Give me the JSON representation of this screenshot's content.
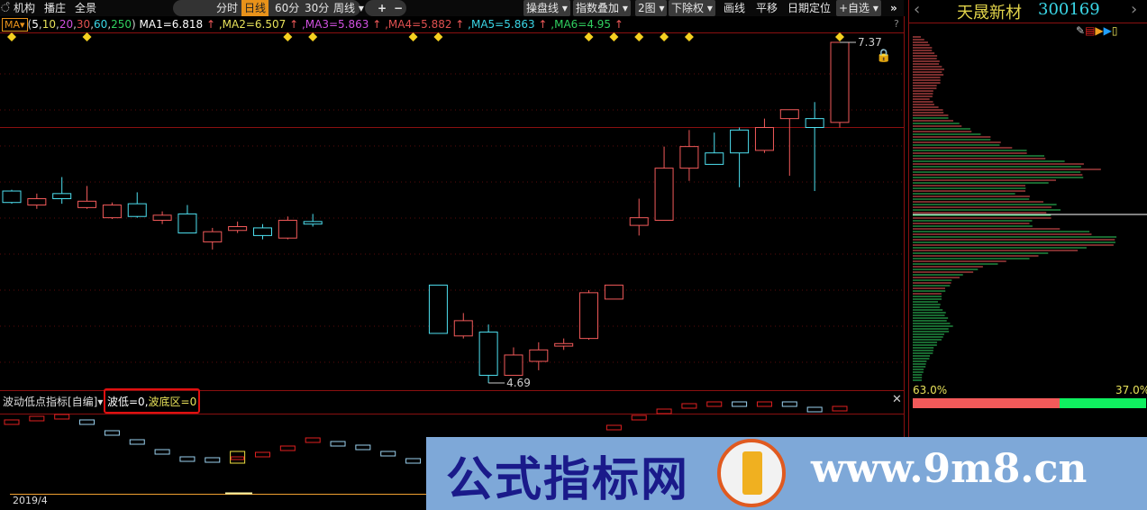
{
  "toolbar": {
    "left_items": [
      "机构",
      "播庄",
      "全景"
    ],
    "periods": [
      "分时",
      "日线",
      "60分",
      "30分",
      "周线"
    ],
    "active_period": "日线",
    "zoom_in": "+",
    "zoom_out": "−",
    "right_items": [
      "操盘线",
      "指数叠加",
      "2图",
      "下除权"
    ],
    "plain_items": [
      "画线",
      "平移",
      "日期定位"
    ],
    "watchlist": "+自选",
    "expand": "»"
  },
  "ma": {
    "button": "MA",
    "params_open": "(",
    "params": [
      {
        "t": "5",
        "c": "#ffffff"
      },
      {
        "t": "10",
        "c": "#e8e25a"
      },
      {
        "t": "20",
        "c": "#d050e0"
      },
      {
        "t": "30",
        "c": "#e05050"
      },
      {
        "t": "60",
        "c": "#3ad6e6"
      },
      {
        "t": "250",
        "c": "#30d060"
      }
    ],
    "params_close": ")",
    "values": [
      {
        "t": "MA1=6.818",
        "c": "#ffffff"
      },
      {
        "t": ",MA2=6.507",
        "c": "#e8e25a"
      },
      {
        "t": ",MA3=5.863",
        "c": "#d050e0"
      },
      {
        "t": ",MA4=5.882",
        "c": "#e05050"
      },
      {
        "t": ",MA5=5.863",
        "c": "#3ad6e6"
      },
      {
        "t": ",MA6=4.95",
        "c": "#30d060"
      }
    ],
    "up_arrow": "↑"
  },
  "help": "?",
  "lock_icon": "lock",
  "chart_data": {
    "type": "candlestick",
    "ylim": [
      4.6,
      7.45
    ],
    "high_label": "7.37",
    "low_label": "4.69",
    "slots": 34,
    "ref_line": 6.7,
    "candles": [
      {
        "i": 0,
        "o": 6.2,
        "c": 6.11,
        "h": 6.21,
        "l": 6.1
      },
      {
        "i": 1,
        "o": 6.09,
        "c": 6.14,
        "h": 6.18,
        "l": 6.06
      },
      {
        "i": 2,
        "o": 6.18,
        "c": 6.14,
        "h": 6.31,
        "l": 6.1
      },
      {
        "i": 3,
        "o": 6.07,
        "c": 6.12,
        "h": 6.24,
        "l": 6.06
      },
      {
        "i": 4,
        "o": 5.99,
        "c": 6.09,
        "h": 6.11,
        "l": 5.98
      },
      {
        "i": 5,
        "o": 6.1,
        "c": 6.0,
        "h": 6.19,
        "l": 5.99
      },
      {
        "i": 6,
        "o": 5.97,
        "c": 6.01,
        "h": 6.04,
        "l": 5.94
      },
      {
        "i": 7,
        "o": 6.02,
        "c": 5.87,
        "h": 6.09,
        "l": 5.87
      },
      {
        "i": 8,
        "o": 5.8,
        "c": 5.88,
        "h": 5.91,
        "l": 5.74
      },
      {
        "i": 9,
        "o": 5.89,
        "c": 5.92,
        "h": 5.96,
        "l": 5.87
      },
      {
        "i": 10,
        "o": 5.91,
        "c": 5.85,
        "h": 5.94,
        "l": 5.82
      },
      {
        "i": 11,
        "o": 5.83,
        "c": 5.97,
        "h": 6.0,
        "l": 5.82
      },
      {
        "i": 12,
        "o": 5.96,
        "c": 5.94,
        "h": 6.02,
        "l": 5.92
      },
      {
        "i": 17,
        "o": 5.46,
        "c": 5.08,
        "h": 5.46,
        "l": 5.08
      },
      {
        "i": 18,
        "o": 5.06,
        "c": 5.18,
        "h": 5.24,
        "l": 5.04
      },
      {
        "i": 19,
        "o": 5.09,
        "c": 4.75,
        "h": 5.15,
        "l": 4.69
      },
      {
        "i": 20,
        "o": 4.75,
        "c": 4.91,
        "h": 4.97,
        "l": 4.75
      },
      {
        "i": 21,
        "o": 4.86,
        "c": 4.95,
        "h": 5.01,
        "l": 4.79
      },
      {
        "i": 22,
        "o": 4.98,
        "c": 5.0,
        "h": 5.04,
        "l": 4.95
      },
      {
        "i": 23,
        "o": 5.04,
        "c": 5.4,
        "h": 5.42,
        "l": 5.03
      },
      {
        "i": 24,
        "o": 5.35,
        "c": 5.46,
        "h": 5.46,
        "l": 5.35
      },
      {
        "i": 25,
        "o": 5.93,
        "c": 5.99,
        "h": 6.14,
        "l": 5.85
      },
      {
        "i": 26,
        "o": 5.97,
        "c": 6.38,
        "h": 6.55,
        "l": 5.97
      },
      {
        "i": 27,
        "o": 6.38,
        "c": 6.55,
        "h": 6.68,
        "l": 6.28
      },
      {
        "i": 28,
        "o": 6.5,
        "c": 6.41,
        "h": 6.66,
        "l": 6.41
      },
      {
        "i": 29,
        "o": 6.68,
        "c": 6.5,
        "h": 6.7,
        "l": 6.23
      },
      {
        "i": 30,
        "o": 6.52,
        "c": 6.7,
        "h": 6.77,
        "l": 6.5
      },
      {
        "i": 31,
        "o": 6.77,
        "c": 6.84,
        "h": 6.84,
        "l": 6.32
      },
      {
        "i": 32,
        "o": 6.77,
        "c": 6.7,
        "h": 6.9,
        "l": 6.2
      },
      {
        "i": 33,
        "o": 6.74,
        "c": 7.37,
        "h": 7.37,
        "l": 6.7
      }
    ],
    "signals": [
      0,
      3,
      11,
      12,
      16,
      17,
      23,
      24,
      25,
      26,
      27,
      33
    ],
    "indicator": [
      {
        "i": 0,
        "v": 7.6,
        "c": "red"
      },
      {
        "i": 1,
        "v": 8.0,
        "c": "red"
      },
      {
        "i": 2,
        "v": 8.2,
        "c": "red"
      },
      {
        "i": 3,
        "v": 7.6,
        "c": "blue"
      },
      {
        "i": 4,
        "v": 6.4,
        "c": "blue"
      },
      {
        "i": 5,
        "v": 5.4,
        "c": "blue"
      },
      {
        "i": 6,
        "v": 4.3,
        "c": "blue"
      },
      {
        "i": 7,
        "v": 3.5,
        "c": "blue"
      },
      {
        "i": 8,
        "v": 3.4,
        "c": "blue"
      },
      {
        "i": 9,
        "v": 3.8,
        "c": "yellow"
      },
      {
        "i": 10,
        "v": 4.0,
        "c": "red"
      },
      {
        "i": 11,
        "v": 4.7,
        "c": "red"
      },
      {
        "i": 12,
        "v": 5.6,
        "c": "red"
      },
      {
        "i": 13,
        "v": 5.2,
        "c": "blue"
      },
      {
        "i": 14,
        "v": 4.8,
        "c": "blue"
      },
      {
        "i": 15,
        "v": 4.1,
        "c": "blue"
      },
      {
        "i": 16,
        "v": 3.3,
        "c": "blue"
      },
      {
        "i": 24,
        "v": 7.0,
        "c": "red"
      },
      {
        "i": 25,
        "v": 8.1,
        "c": "red"
      },
      {
        "i": 26,
        "v": 8.8,
        "c": "red"
      },
      {
        "i": 27,
        "v": 9.4,
        "c": "red"
      },
      {
        "i": 28,
        "v": 9.6,
        "c": "red"
      },
      {
        "i": 29,
        "v": 9.6,
        "c": "blue"
      },
      {
        "i": 30,
        "v": 9.6,
        "c": "red"
      },
      {
        "i": 31,
        "v": 9.6,
        "c": "blue"
      },
      {
        "i": 32,
        "v": 9.0,
        "c": "blue"
      },
      {
        "i": 33,
        "v": 9.1,
        "c": "red"
      }
    ],
    "indicator_ylim": [
      0,
      10
    ]
  },
  "indicator": {
    "name": "波动低点指标[自编]",
    "label1": "波低=0,",
    "label2": "波底区=0"
  },
  "date_label": "2019/4",
  "stock": {
    "name": "天晟新材",
    "code": "300169"
  },
  "profile": {
    "red_pct": 63.0,
    "green_pct": 37.0,
    "red_label": "63.0%",
    "green_label": "37.0%",
    "shape": [
      10,
      20,
      25,
      30,
      35,
      35,
      30,
      25,
      20,
      30,
      40,
      50,
      70,
      90,
      110,
      140,
      180,
      215,
      190,
      140,
      120,
      150,
      170,
      160,
      130,
      200,
      250,
      210,
      150,
      100,
      70,
      50,
      40,
      35,
      30,
      35,
      40,
      45,
      40,
      30,
      25,
      20,
      15,
      12,
      10
    ]
  },
  "watermark": {
    "cn": "公式指标网",
    "url": "www.9m8.cn"
  },
  "colors": {
    "up": "#f25a5a",
    "down": "#4ee0f0",
    "grid": "#8a1010",
    "signal": "#f5d020"
  }
}
